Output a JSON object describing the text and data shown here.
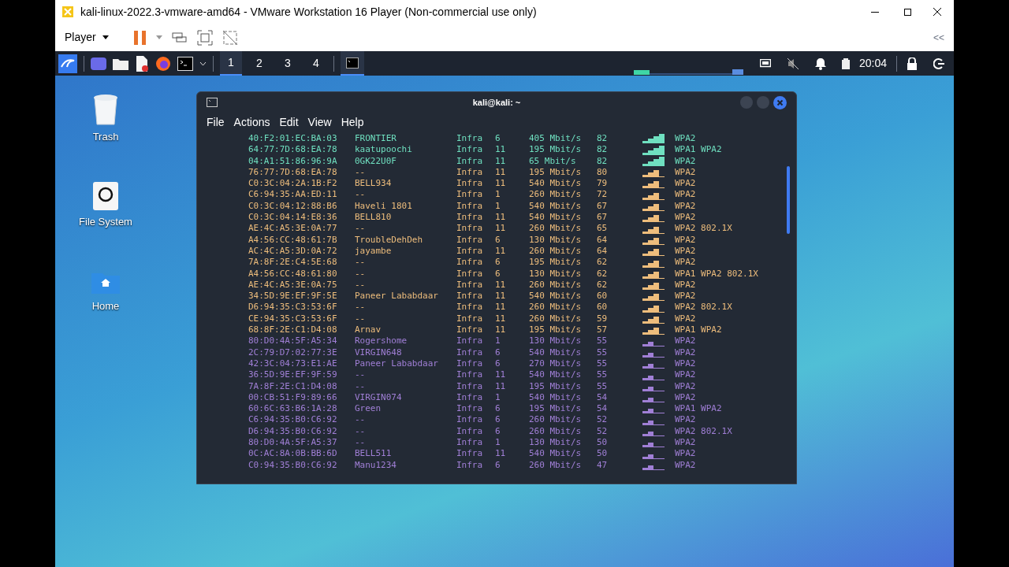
{
  "host_window": {
    "title": "kali-linux-2022.3-vmware-amd64 - VMware Workstation 16 Player (Non-commercial use only)",
    "player_menu": "Player",
    "collapse": "<<"
  },
  "taskbar": {
    "workspaces": [
      {
        "label": "1",
        "selected": true
      },
      {
        "label": "2",
        "selected": false
      },
      {
        "label": "3",
        "selected": false
      },
      {
        "label": "4",
        "selected": false
      }
    ],
    "clock": "20:04"
  },
  "desktop_icons": [
    {
      "label": "Trash",
      "kind": "trash"
    },
    {
      "label": "File System",
      "kind": "drive"
    },
    {
      "label": "Home",
      "kind": "home"
    }
  ],
  "terminal": {
    "title": "kali@kali: ~",
    "menu": [
      "File",
      "Actions",
      "Edit",
      "View",
      "Help"
    ],
    "rows": [
      {
        "bssid": "40:F2:01:EC:BA:03",
        "ssid": "FRONTIER",
        "mode": "Infra",
        "chan": "6",
        "rate": "405 Mbit/s",
        "signal": "82",
        "security": "WPA2",
        "kind": "strong",
        "color": "#6fe0c0"
      },
      {
        "bssid": "64:77:7D:68:EA:78",
        "ssid": "kaatupoochi",
        "mode": "Infra",
        "chan": "11",
        "rate": "195 Mbit/s",
        "signal": "82",
        "security": "WPA1 WPA2",
        "kind": "strong",
        "color": "#6fe0c0"
      },
      {
        "bssid": "04:A1:51:86:96:9A",
        "ssid": "0GK22U0F",
        "mode": "Infra",
        "chan": "11",
        "rate": "65 Mbit/s",
        "signal": "82",
        "security": "WPA2",
        "kind": "strong",
        "color": "#6fe0c0"
      },
      {
        "bssid": "76:77:7D:68:EA:78",
        "ssid": "--",
        "mode": "Infra",
        "chan": "11",
        "rate": "195 Mbit/s",
        "signal": "80",
        "security": "WPA2",
        "kind": "medium",
        "color": "#eebd7c"
      },
      {
        "bssid": "C0:3C:04:2A:1B:F2",
        "ssid": "BELL934",
        "mode": "Infra",
        "chan": "11",
        "rate": "540 Mbit/s",
        "signal": "79",
        "security": "WPA2",
        "kind": "medium",
        "color": "#eebd7c"
      },
      {
        "bssid": "C6:94:35:AA:ED:11",
        "ssid": "--",
        "mode": "Infra",
        "chan": "1",
        "rate": "260 Mbit/s",
        "signal": "72",
        "security": "WPA2",
        "kind": "medium",
        "color": "#eebd7c"
      },
      {
        "bssid": "C0:3C:04:12:88:B6",
        "ssid": "Haveli 1801",
        "mode": "Infra",
        "chan": "1",
        "rate": "540 Mbit/s",
        "signal": "67",
        "security": "WPA2",
        "kind": "medium",
        "color": "#eebd7c"
      },
      {
        "bssid": "C0:3C:04:14:E8:36",
        "ssid": "BELL810",
        "mode": "Infra",
        "chan": "11",
        "rate": "540 Mbit/s",
        "signal": "67",
        "security": "WPA2",
        "kind": "medium",
        "color": "#eebd7c"
      },
      {
        "bssid": "AE:4C:A5:3E:0A:77",
        "ssid": "--",
        "mode": "Infra",
        "chan": "11",
        "rate": "260 Mbit/s",
        "signal": "65",
        "security": "WPA2 802.1X",
        "kind": "medium",
        "color": "#eebd7c"
      },
      {
        "bssid": "A4:56:CC:48:61:7B",
        "ssid": "TroubleDehDeh",
        "mode": "Infra",
        "chan": "6",
        "rate": "130 Mbit/s",
        "signal": "64",
        "security": "WPA2",
        "kind": "medium",
        "color": "#eebd7c"
      },
      {
        "bssid": "AC:4C:A5:3D:0A:72",
        "ssid": "jayambe",
        "mode": "Infra",
        "chan": "11",
        "rate": "260 Mbit/s",
        "signal": "64",
        "security": "WPA2",
        "kind": "medium",
        "color": "#eebd7c"
      },
      {
        "bssid": "7A:8F:2E:C4:5E:68",
        "ssid": "--",
        "mode": "Infra",
        "chan": "6",
        "rate": "195 Mbit/s",
        "signal": "62",
        "security": "WPA2",
        "kind": "medium",
        "color": "#eebd7c"
      },
      {
        "bssid": "A4:56:CC:48:61:80",
        "ssid": "--",
        "mode": "Infra",
        "chan": "6",
        "rate": "130 Mbit/s",
        "signal": "62",
        "security": "WPA1 WPA2 802.1X",
        "kind": "medium",
        "color": "#eebd7c"
      },
      {
        "bssid": "AE:4C:A5:3E:0A:75",
        "ssid": "--",
        "mode": "Infra",
        "chan": "11",
        "rate": "260 Mbit/s",
        "signal": "62",
        "security": "WPA2",
        "kind": "medium",
        "color": "#eebd7c"
      },
      {
        "bssid": "34:5D:9E:EF:9F:5E",
        "ssid": "Paneer Lababdaar",
        "mode": "Infra",
        "chan": "11",
        "rate": "540 Mbit/s",
        "signal": "60",
        "security": "WPA2",
        "kind": "medium",
        "color": "#eebd7c"
      },
      {
        "bssid": "D6:94:35:C3:53:6F",
        "ssid": "--",
        "mode": "Infra",
        "chan": "11",
        "rate": "260 Mbit/s",
        "signal": "60",
        "security": "WPA2 802.1X",
        "kind": "medium",
        "color": "#eebd7c"
      },
      {
        "bssid": "CE:94:35:C3:53:6F",
        "ssid": "--",
        "mode": "Infra",
        "chan": "11",
        "rate": "260 Mbit/s",
        "signal": "59",
        "security": "WPA2",
        "kind": "medium",
        "color": "#eebd7c"
      },
      {
        "bssid": "68:8F:2E:C1:D4:08",
        "ssid": "Arnav",
        "mode": "Infra",
        "chan": "11",
        "rate": "195 Mbit/s",
        "signal": "57",
        "security": "WPA1 WPA2",
        "kind": "medium",
        "color": "#eebd7c"
      },
      {
        "bssid": "80:D0:4A:5F:A5:34",
        "ssid": "Rogershome",
        "mode": "Infra",
        "chan": "1",
        "rate": "130 Mbit/s",
        "signal": "55",
        "security": "WPA2",
        "kind": "weak",
        "color": "#a07fd6"
      },
      {
        "bssid": "2C:79:D7:02:77:3E",
        "ssid": "VIRGIN648",
        "mode": "Infra",
        "chan": "6",
        "rate": "540 Mbit/s",
        "signal": "55",
        "security": "WPA2",
        "kind": "weak",
        "color": "#a07fd6"
      },
      {
        "bssid": "42:3C:04:73:E1:AE",
        "ssid": "Paneer Lababdaar",
        "mode": "Infra",
        "chan": "6",
        "rate": "270 Mbit/s",
        "signal": "55",
        "security": "WPA2",
        "kind": "weak",
        "color": "#a07fd6"
      },
      {
        "bssid": "36:5D:9E:EF:9F:59",
        "ssid": "--",
        "mode": "Infra",
        "chan": "11",
        "rate": "540 Mbit/s",
        "signal": "55",
        "security": "WPA2",
        "kind": "weak",
        "color": "#a07fd6"
      },
      {
        "bssid": "7A:8F:2E:C1:D4:08",
        "ssid": "--",
        "mode": "Infra",
        "chan": "11",
        "rate": "195 Mbit/s",
        "signal": "55",
        "security": "WPA2",
        "kind": "weak",
        "color": "#a07fd6"
      },
      {
        "bssid": "00:CB:51:F9:89:66",
        "ssid": "VIRGIN074",
        "mode": "Infra",
        "chan": "1",
        "rate": "540 Mbit/s",
        "signal": "54",
        "security": "WPA2",
        "kind": "weak",
        "color": "#a07fd6"
      },
      {
        "bssid": "60:6C:63:B6:1A:28",
        "ssid": "Green",
        "mode": "Infra",
        "chan": "6",
        "rate": "195 Mbit/s",
        "signal": "54",
        "security": "WPA1 WPA2",
        "kind": "weak",
        "color": "#a07fd6"
      },
      {
        "bssid": "C6:94:35:B0:C6:92",
        "ssid": "--",
        "mode": "Infra",
        "chan": "6",
        "rate": "260 Mbit/s",
        "signal": "52",
        "security": "WPA2",
        "kind": "weak",
        "color": "#a07fd6"
      },
      {
        "bssid": "D6:94:35:B0:C6:92",
        "ssid": "--",
        "mode": "Infra",
        "chan": "6",
        "rate": "260 Mbit/s",
        "signal": "52",
        "security": "WPA2 802.1X",
        "kind": "weak",
        "color": "#a07fd6"
      },
      {
        "bssid": "80:D0:4A:5F:A5:37",
        "ssid": "--",
        "mode": "Infra",
        "chan": "1",
        "rate": "130 Mbit/s",
        "signal": "50",
        "security": "WPA2",
        "kind": "weak",
        "color": "#a07fd6"
      },
      {
        "bssid": "0C:AC:8A:0B:BB:6D",
        "ssid": "BELL511",
        "mode": "Infra",
        "chan": "11",
        "rate": "540 Mbit/s",
        "signal": "50",
        "security": "WPA2",
        "kind": "weak",
        "color": "#a07fd6"
      },
      {
        "bssid": "C0:94:35:B0:C6:92",
        "ssid": "Manu1234",
        "mode": "Infra",
        "chan": "6",
        "rate": "260 Mbit/s",
        "signal": "47",
        "security": "WPA2",
        "kind": "weak",
        "color": "#a07fd6"
      }
    ]
  }
}
